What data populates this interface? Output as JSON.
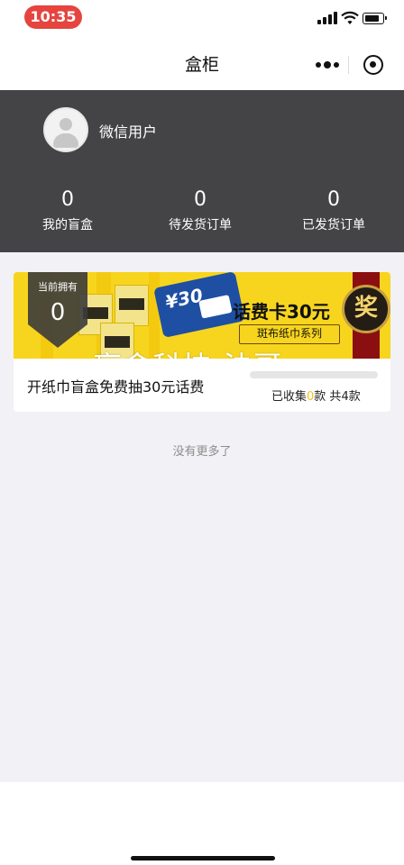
{
  "status_bar": {
    "time": "10:35",
    "icons": [
      "cellular-signal-icon",
      "wifi-icon",
      "battery-icon"
    ]
  },
  "nav": {
    "title": "盒柜",
    "more_icon": "more-dots-icon",
    "close_icon": "mini-program-close-icon"
  },
  "profile": {
    "user_name": "微信用户",
    "avatar_icon": "default-avatar-icon",
    "stats": [
      {
        "value": "0",
        "label": "我的盲盒"
      },
      {
        "value": "0",
        "label": "待发货订单"
      },
      {
        "value": "0",
        "label": "已发货订单"
      }
    ]
  },
  "card": {
    "owned_label": "当前拥有",
    "owned_count": "0",
    "banner": {
      "card_value": "¥30",
      "headline": "话费卡30元",
      "subline": "斑布纸巾系列",
      "badge": "奖"
    },
    "watermark": "盲盒科技-法哥",
    "title": "开纸巾盲盒免费抽30元话费",
    "collected_prefix": "已收集",
    "collected_count": "0",
    "collected_mid": "款 共",
    "total_count": "4",
    "collected_suffix": "款",
    "progress": 0.0
  },
  "footer": {
    "no_more": "没有更多了"
  },
  "colors": {
    "time_pill": "#e5443f",
    "header_bg": "#444446",
    "banner_yellow": "#f7d51e",
    "highlight": "#f2c21b",
    "page_bg": "#f2f1f5"
  }
}
